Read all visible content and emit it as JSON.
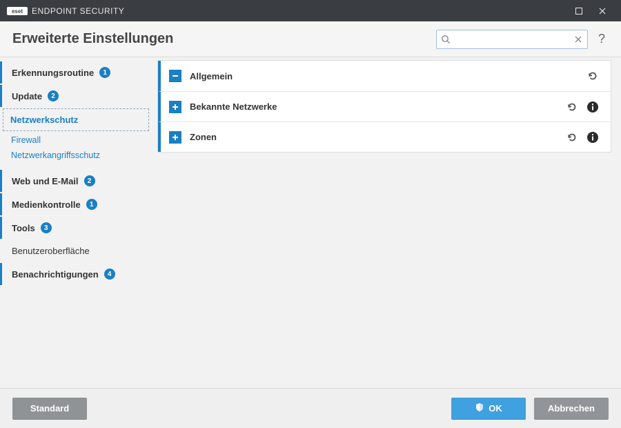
{
  "titlebar": {
    "brand": "ENDPOINT SECURITY"
  },
  "header": {
    "title": "Erweiterte Einstellungen",
    "help": "?"
  },
  "search": {
    "placeholder": ""
  },
  "sidebar": {
    "items": [
      {
        "label": "Erkennungsroutine",
        "badge": "1"
      },
      {
        "label": "Update",
        "badge": "2"
      },
      {
        "label": "Netzwerkschutz"
      },
      {
        "label": "Firewall"
      },
      {
        "label": "Netzwerkangriffsschutz"
      },
      {
        "label": "Web und E-Mail",
        "badge": "2"
      },
      {
        "label": "Medienkontrolle",
        "badge": "1"
      },
      {
        "label": "Tools",
        "badge": "3"
      },
      {
        "label": "Benutzeroberfläche"
      },
      {
        "label": "Benachrichtigungen",
        "badge": "4"
      }
    ]
  },
  "sections": [
    {
      "title": "Allgemein",
      "expanded": true,
      "hasInfo": false
    },
    {
      "title": "Bekannte Netzwerke",
      "expanded": false,
      "hasInfo": true
    },
    {
      "title": "Zonen",
      "expanded": false,
      "hasInfo": true
    }
  ],
  "footer": {
    "default": "Standard",
    "ok": "OK",
    "cancel": "Abbrechen"
  }
}
